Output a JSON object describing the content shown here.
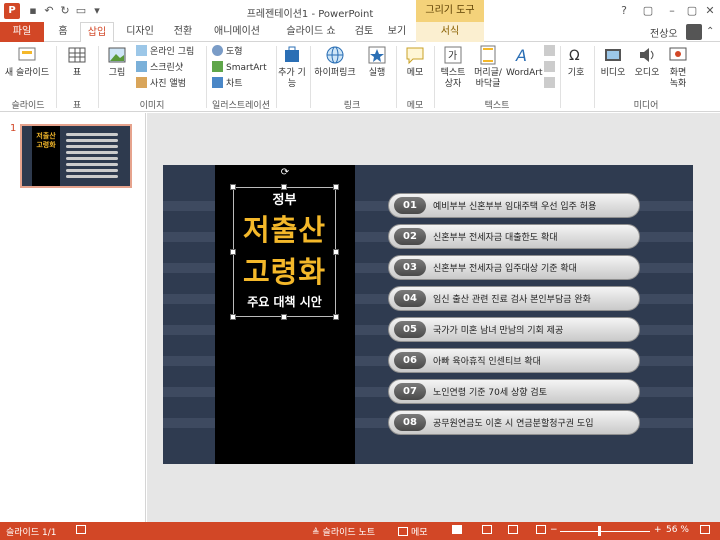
{
  "window": {
    "title": "프레젠테이션1 - PowerPoint",
    "context_title": "그리기 도구",
    "logo_letter": "P",
    "user": "전상오",
    "controls": [
      "?",
      "▢",
      "–",
      "▢",
      "✕"
    ]
  },
  "tabs": [
    {
      "label": "파일"
    },
    {
      "label": "홈"
    },
    {
      "label": "삽입"
    },
    {
      "label": "디자인"
    },
    {
      "label": "전환"
    },
    {
      "label": "애니메이션"
    },
    {
      "label": "슬라이드 쇼"
    },
    {
      "label": "검토"
    },
    {
      "label": "보기"
    },
    {
      "label": "서식"
    }
  ],
  "ribbon": {
    "new_slide": "새 슬라이드",
    "table": "표",
    "picture": "그림",
    "online_picture": "온라인 그림",
    "screenshot": "스크린샷",
    "photo_album": "사진 앨범",
    "shapes": "도형",
    "smartart": "SmartArt",
    "chart": "차트",
    "addins": "추가 기능",
    "hyperlink": "하이퍼링크",
    "action": "실행",
    "comment": "메모",
    "textbox_1": "텍스트",
    "textbox_2": "상자",
    "header_1": "머리글/",
    "header_2": "바닥글",
    "wordart": "WordArt",
    "symbol": "기호",
    "video": "비디오",
    "audio": "오디오",
    "record_1": "화면",
    "record_2": "녹화",
    "groups": {
      "slides": "슬라이드",
      "tables": "표",
      "images": "이미지",
      "illustrations": "일러스트레이션",
      "links": "링크",
      "comments": "메모",
      "text": "텍스트",
      "media": "미디어"
    }
  },
  "thumbnail": {
    "number": "1"
  },
  "slide": {
    "gov": "정부",
    "big1": "저출산",
    "big2": "고령화",
    "sub": "주요 대책 시안",
    "items": [
      {
        "num": "01",
        "text": "예비부부 신혼부부 임대주택 우선 입주 허용"
      },
      {
        "num": "02",
        "text": "신혼부부 전세자금 대출한도 확대"
      },
      {
        "num": "03",
        "text": "신혼부부 전세자금 입주대상 기준 확대"
      },
      {
        "num": "04",
        "text": "임신 출산 관련 진료 검사 본인부담금 완화"
      },
      {
        "num": "05",
        "text": "국가가 미혼 남녀 만남의 기회 제공"
      },
      {
        "num": "06",
        "text": "아빠 육아휴직 인센티브 확대"
      },
      {
        "num": "07",
        "text": "노인연령 기준 70세 상향 검토"
      },
      {
        "num": "08",
        "text": "공무원연금도 이혼 시 연금분할청구권 도입"
      }
    ]
  },
  "status": {
    "slide_count": "슬라이드 1/1",
    "notes": "슬라이드 노트",
    "comments": "메모",
    "zoom_minus": "−",
    "zoom_plus": "+",
    "zoom": "56 %"
  },
  "colors": {
    "accent": "#d24726",
    "title_yellow": "#f4b82a",
    "slide_bg": "#2f3b50"
  }
}
